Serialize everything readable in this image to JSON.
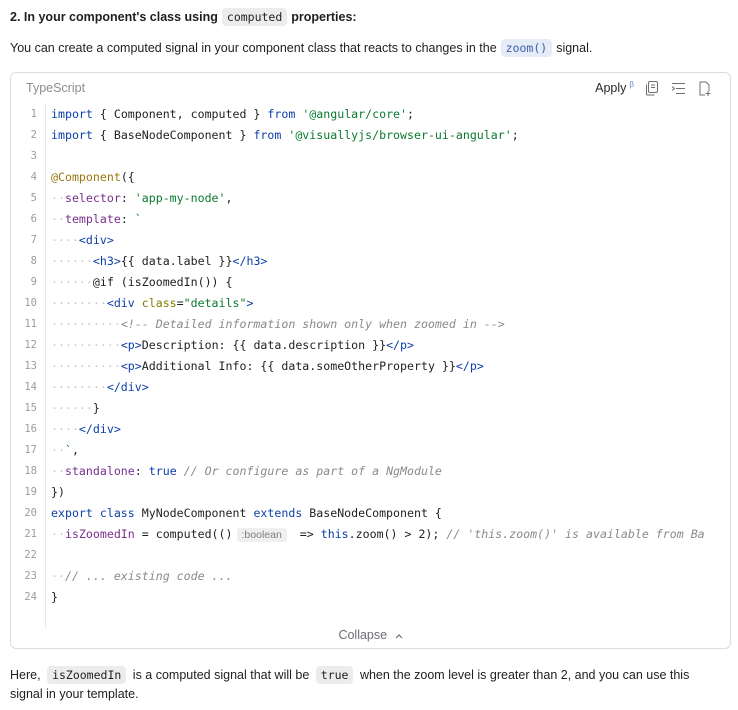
{
  "heading": {
    "prefix": "2. In your component's class using",
    "code": "computed",
    "suffix": "properties:"
  },
  "intro": {
    "before": "You can create a computed signal in your component class that reacts to changes in the",
    "code": "zoom()",
    "after": "signal."
  },
  "code_block": {
    "language": "TypeScript",
    "apply_label": "Apply",
    "apply_badge": "β",
    "collapse_label": "Collapse",
    "lines": [
      {
        "n": "1",
        "indent": 0,
        "parts": [
          [
            "kw",
            "import "
          ],
          [
            "tx",
            "{ Component, computed } "
          ],
          [
            "kw",
            "from "
          ],
          [
            "str",
            "'@angular/core'"
          ],
          [
            "tx",
            ";"
          ]
        ]
      },
      {
        "n": "2",
        "indent": 0,
        "parts": [
          [
            "kw",
            "import "
          ],
          [
            "tx",
            "{ BaseNodeComponent } "
          ],
          [
            "kw",
            "from "
          ],
          [
            "str",
            "'@visuallyjs/browser-ui-angular'"
          ],
          [
            "tx",
            ";"
          ]
        ]
      },
      {
        "n": "3",
        "indent": 0,
        "parts": []
      },
      {
        "n": "4",
        "indent": 0,
        "parts": [
          [
            "ann",
            "@Component"
          ],
          [
            "tx",
            "({"
          ]
        ]
      },
      {
        "n": "5",
        "indent": 2,
        "parts": [
          [
            "prop",
            "selector"
          ],
          [
            "tx",
            ": "
          ],
          [
            "str",
            "'app-my-node'"
          ],
          [
            "tx",
            ","
          ]
        ]
      },
      {
        "n": "6",
        "indent": 2,
        "parts": [
          [
            "prop",
            "template"
          ],
          [
            "tx",
            ": "
          ],
          [
            "str",
            "`"
          ]
        ]
      },
      {
        "n": "7",
        "indent": 4,
        "parts": [
          [
            "tag",
            "<div>"
          ]
        ]
      },
      {
        "n": "8",
        "indent": 6,
        "parts": [
          [
            "tag",
            "<h3>"
          ],
          [
            "tx",
            "{{ data.label }}"
          ],
          [
            "tag",
            "</h3>"
          ]
        ]
      },
      {
        "n": "9",
        "indent": 6,
        "parts": [
          [
            "tx",
            "@if (isZoomedIn()) {"
          ]
        ]
      },
      {
        "n": "10",
        "indent": 8,
        "parts": [
          [
            "tag",
            "<div "
          ],
          [
            "attr",
            "class"
          ],
          [
            "tx",
            "="
          ],
          [
            "str",
            "\"details\""
          ],
          [
            "tag",
            ">"
          ]
        ]
      },
      {
        "n": "11",
        "indent": 10,
        "parts": [
          [
            "cmt",
            "<!-- Detailed information shown only when zoomed in -->"
          ]
        ]
      },
      {
        "n": "12",
        "indent": 10,
        "parts": [
          [
            "tag",
            "<p>"
          ],
          [
            "tx",
            "Description: {{ data.description }}"
          ],
          [
            "tag",
            "</p>"
          ]
        ]
      },
      {
        "n": "13",
        "indent": 10,
        "parts": [
          [
            "tag",
            "<p>"
          ],
          [
            "tx",
            "Additional Info: {{ data.someOtherProperty }}"
          ],
          [
            "tag",
            "</p>"
          ]
        ]
      },
      {
        "n": "14",
        "indent": 8,
        "parts": [
          [
            "tag",
            "</div>"
          ]
        ]
      },
      {
        "n": "15",
        "indent": 6,
        "parts": [
          [
            "tx",
            "}"
          ]
        ]
      },
      {
        "n": "16",
        "indent": 4,
        "parts": [
          [
            "tag",
            "</div>"
          ]
        ]
      },
      {
        "n": "17",
        "indent": 2,
        "parts": [
          [
            "str",
            "`"
          ],
          [
            "tx",
            ","
          ]
        ]
      },
      {
        "n": "18",
        "indent": 2,
        "parts": [
          [
            "prop",
            "standalone"
          ],
          [
            "tx",
            ": "
          ],
          [
            "kw",
            "true "
          ],
          [
            "cmt",
            "// Or configure as part of a NgModule"
          ]
        ]
      },
      {
        "n": "19",
        "indent": 0,
        "parts": [
          [
            "tx",
            "})"
          ]
        ]
      },
      {
        "n": "20",
        "indent": 0,
        "parts": [
          [
            "kw",
            "export class "
          ],
          [
            "tx",
            "MyNodeComponent "
          ],
          [
            "kw",
            "extends "
          ],
          [
            "tx",
            "BaseNodeComponent {"
          ]
        ]
      },
      {
        "n": "21",
        "indent": 2,
        "parts": [
          [
            "prop",
            "isZoomedIn"
          ],
          [
            "tx",
            " = computed(()"
          ],
          [
            "hint",
            ":boolean"
          ],
          [
            "tx",
            " => "
          ],
          [
            "kw",
            "this"
          ],
          [
            "tx",
            ".zoom() > 2); "
          ],
          [
            "cmt",
            "// 'this.zoom()' is available from Ba"
          ]
        ]
      },
      {
        "n": "22",
        "indent": 0,
        "parts": []
      },
      {
        "n": "23",
        "indent": 2,
        "parts": [
          [
            "cmt",
            "// ... existing code ..."
          ]
        ]
      },
      {
        "n": "24",
        "indent": 0,
        "parts": [
          [
            "tx",
            "}"
          ]
        ]
      }
    ]
  },
  "footer": {
    "p1": "Here,",
    "code1": "isZoomedIn",
    "p2": "is a computed signal that will be",
    "code2": "true",
    "p3": "when the zoom level is greater than 2, and you can use this",
    "p4": "signal in your template."
  },
  "icons": [
    "copy-icon",
    "diff-icon",
    "insert-file-icon",
    "chevron-up-icon"
  ]
}
